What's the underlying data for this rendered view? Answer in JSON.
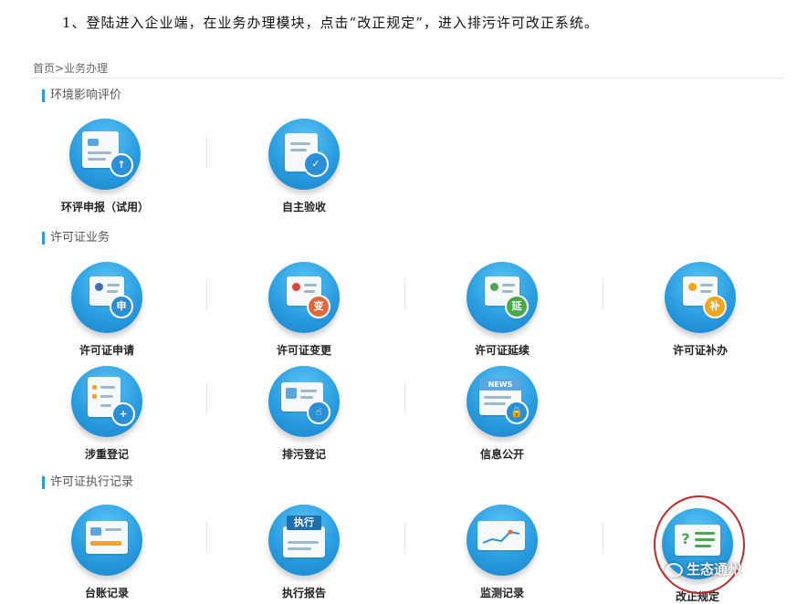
{
  "instruction": "1、登陆进入企业端，在业务办理模块，点击“改正规定”，进入排污许可改正系统。",
  "breadcrumb": {
    "home": "首页",
    "separator": ">",
    "current": "业务办理"
  },
  "sections": [
    {
      "title": "环境影响评价",
      "items": [
        {
          "label": "环评申报（试用）",
          "icon": "document-upload-icon"
        },
        {
          "label": "自主验收",
          "icon": "clipboard-check-icon"
        }
      ]
    },
    {
      "title": "许可证业务",
      "items": [
        {
          "label": "许可证申请",
          "icon": "certificate-apply-icon",
          "badge": "申",
          "badge_color": "#2a8fd6",
          "ribbon_color": "#3b6fb6"
        },
        {
          "label": "许可证变更",
          "icon": "certificate-change-icon",
          "badge": "变",
          "badge_color": "#e0683c",
          "ribbon_color": "#d9463a"
        },
        {
          "label": "许可证延续",
          "icon": "certificate-extend-icon",
          "badge": "延",
          "badge_color": "#49a84a",
          "ribbon_color": "#4aa84b"
        },
        {
          "label": "许可证补办",
          "icon": "certificate-reissue-icon",
          "badge": "补",
          "badge_color": "#f0a51c",
          "ribbon_color": "#f0a51c"
        },
        {
          "label": "涉重登记",
          "icon": "checklist-add-icon"
        },
        {
          "label": "排污登记",
          "icon": "id-card-pointer-icon"
        },
        {
          "label": "信息公开",
          "icon": "news-lock-icon",
          "news_text": "NEWS"
        }
      ]
    },
    {
      "title": "许可证执行记录",
      "items": [
        {
          "label": "台账记录",
          "icon": "ledger-icon"
        },
        {
          "label": "执行报告",
          "icon": "execution-report-icon",
          "badge": "执行"
        },
        {
          "label": "监测记录",
          "icon": "monitor-chart-icon"
        },
        {
          "label": "改正规定",
          "icon": "correction-question-icon",
          "badge": "?",
          "highlighted": true
        }
      ]
    }
  ],
  "watermark": "生态通州",
  "colors": {
    "accent": "#2b9be0",
    "highlight_ring": "#c0282a"
  }
}
